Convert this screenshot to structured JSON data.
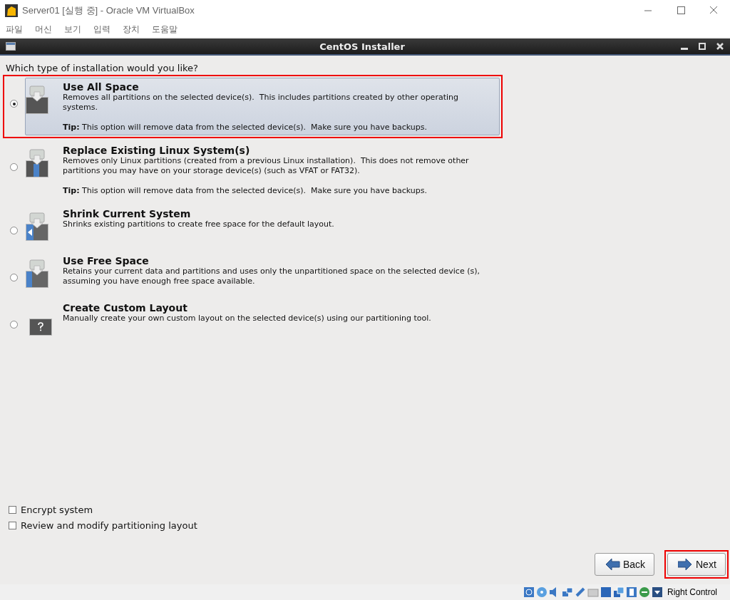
{
  "window": {
    "title": "Server01 [실행 중] - Oracle VM VirtualBox"
  },
  "menu": [
    "파일",
    "머신",
    "보기",
    "입력",
    "장치",
    "도움말"
  ],
  "installer": {
    "title": "CentOS Installer"
  },
  "question": "Which type of installation would you like?",
  "options": [
    {
      "kind": "all",
      "title": "Use All Space",
      "description": "Removes all partitions on the selected device(s).  This includes partitions created by other operating systems.",
      "tip": "**Tip:** This option will remove data from the selected device(s).  Make sure you have backups.",
      "selected": true,
      "highlighted": true
    },
    {
      "kind": "replace",
      "title": "Replace Existing Linux System(s)",
      "description": "Removes only Linux partitions (created from a previous Linux installation).  This does not remove other partitions you may have on your storage device(s) (such as VFAT or FAT32).",
      "tip": "**Tip:** This option will remove data from the selected device(s).  Make sure you have backups.",
      "selected": false,
      "highlighted": false
    },
    {
      "kind": "shrink",
      "title": "Shrink Current System",
      "description": "Shrinks existing partitions to create free space for the default layout.",
      "selected": false,
      "highlighted": false
    },
    {
      "kind": "free",
      "title": "Use Free Space",
      "description": "Retains your current data and partitions and uses only the unpartitioned space on the selected device (s), assuming you have enough free space available.",
      "selected": false,
      "highlighted": false
    },
    {
      "kind": "custom",
      "title": "Create Custom Layout",
      "description": "Manually create your own custom layout on the selected device(s) using our partitioning tool.",
      "selected": false,
      "highlighted": false
    }
  ],
  "checkboxes": [
    {
      "label": "Encrypt system",
      "checked": false
    },
    {
      "label": "Review and modify partitioning layout",
      "checked": false
    }
  ],
  "buttons": [
    {
      "kind": "back",
      "label": "Back",
      "highlighted": false
    },
    {
      "kind": "next",
      "label": "Next",
      "highlighted": true
    }
  ],
  "status_bar": {
    "host_key": "Right Control"
  }
}
